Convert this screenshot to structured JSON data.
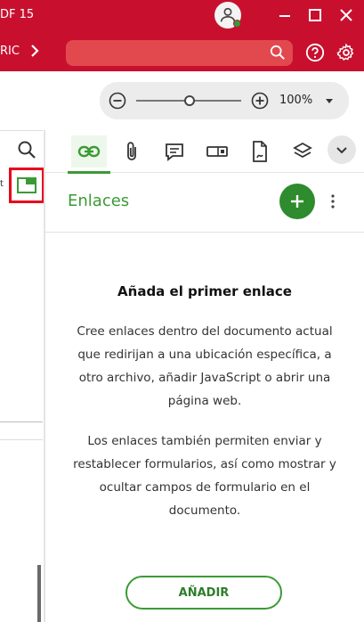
{
  "titlebar": {
    "doc_title": "DF 15",
    "window_controls": [
      "minimize",
      "maximize",
      "close"
    ]
  },
  "toolbar": {
    "ribbon_label": "RIC",
    "search": {
      "value": "",
      "placeholder": ""
    },
    "icons": [
      "search-icon",
      "help-icon",
      "gear-icon"
    ]
  },
  "zoom": {
    "value": "100%",
    "level_percent": 100
  },
  "left_strip": {
    "cut_text": "t"
  },
  "panel": {
    "tabs": [
      "link-icon",
      "paperclip-icon",
      "comment-icon",
      "form-field-icon",
      "signature-icon",
      "layers-icon",
      "chevron-down-icon"
    ],
    "active_tab": "link-icon",
    "title": "Enlaces",
    "empty": {
      "title": "Añada el primer enlace",
      "text1": "Cree enlaces dentro del documento actual que redirijan a una ubicación específica, a otro archivo, añadir JavaScript o abrir una página web.",
      "text2": "Los enlaces también permiten enviar y restablecer formularios, así como mostrar y ocultar campos de formulario en el documento."
    },
    "add_button": "AÑADIR"
  },
  "colors": {
    "brand_red": "#c8102e",
    "accent_green": "#3a9b35",
    "highlight_red": "#e8001c"
  }
}
